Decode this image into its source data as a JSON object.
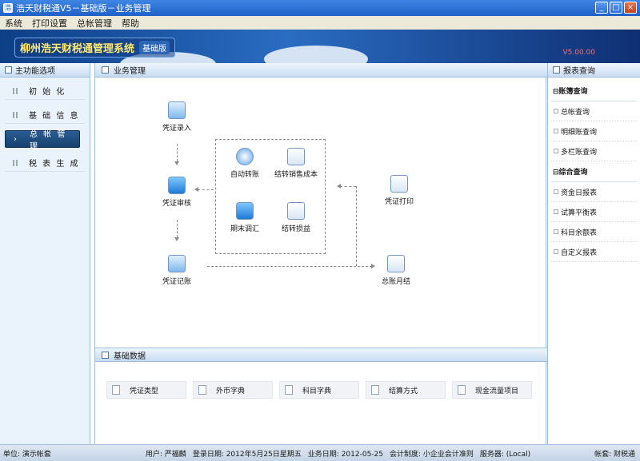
{
  "window": {
    "title": "浩天财税通V5－基础版－业务管理",
    "controls": [
      "_",
      "□",
      "×"
    ]
  },
  "menu": [
    "系统",
    "打印设置",
    "总帐管理",
    "帮助"
  ],
  "banner": {
    "system_name": "柳州浩天财税通管理系统",
    "edition": "基础版",
    "version": "V5.00.00"
  },
  "left_panel": {
    "title": "主功能选项",
    "items": [
      {
        "label": "初 始 化",
        "active": false
      },
      {
        "label": "基 础 信 息",
        "active": false
      },
      {
        "label": "总 帐 管 理",
        "active": true
      },
      {
        "label": "税 表 生 成",
        "active": false
      }
    ]
  },
  "business": {
    "title": "业务管理",
    "nodes": {
      "voucher_entry": "凭证录入",
      "voucher_audit": "凭证审核",
      "voucher_post": "凭证记账",
      "auto_transfer": "自动转账",
      "carry_sales_cost": "结转销售成本",
      "period_adjust": "期末调汇",
      "carry_pl": "结转损益",
      "voucher_print": "凭证打印",
      "month_close": "总账月结"
    }
  },
  "basic_data": {
    "title": "基础数据",
    "items": [
      "凭证类型",
      "外币字典",
      "科目字典",
      "结算方式",
      "现金流量项目"
    ]
  },
  "right_panel": {
    "title": "报表查询",
    "sections": [
      {
        "label": "账簿查询",
        "items": [
          "总帐查询",
          "明细账查询",
          "多栏账查询"
        ]
      },
      {
        "label": "综合查询",
        "items": [
          "资金日报表",
          "试算平衡表",
          "科目余额表",
          "自定义报表"
        ]
      }
    ]
  },
  "status": {
    "unit": "单位: 演示帐套",
    "user": "用户: 严福麟",
    "login_date": "登录日期: 2012年5月25日星期五",
    "biz_date": "业务日期: 2012-05-25",
    "accounting": "会计制度: 小企业会计准则",
    "server": "服务器: (Local)",
    "book": "帐套: 财税通"
  },
  "colors": {
    "title_bar": "#1f5fc8",
    "panel_header": "#c8dcf2",
    "active_nav": "#16426f",
    "version_text": "#ff6a6a"
  }
}
